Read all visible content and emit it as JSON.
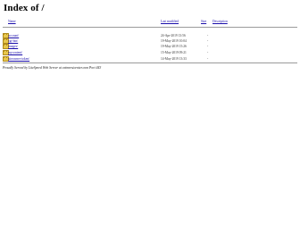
{
  "title": "Index of /",
  "columns": {
    "name": "Name",
    "last_modified": "Last modified",
    "size": "Size",
    "description": "Description"
  },
  "rows": [
    {
      "name": "account/",
      "modified": "24-Apr-2019 13:56",
      "size": "-"
    },
    {
      "name": "cgi-bin/",
      "modified": "19-May-2019 10:04",
      "size": "-"
    },
    {
      "name": "images/",
      "modified": "19-May-2019 15:26",
      "size": "-"
    },
    {
      "name": "mycontent/",
      "modified": "15-May-2019 09:21",
      "size": "-"
    },
    {
      "name": "siteowner-token/",
      "modified": "14-May-2019 13:33",
      "size": "-"
    }
  ],
  "footer": "Proudly Served by LiteSpeed Web Server at eximrestcenter.com Port 443"
}
